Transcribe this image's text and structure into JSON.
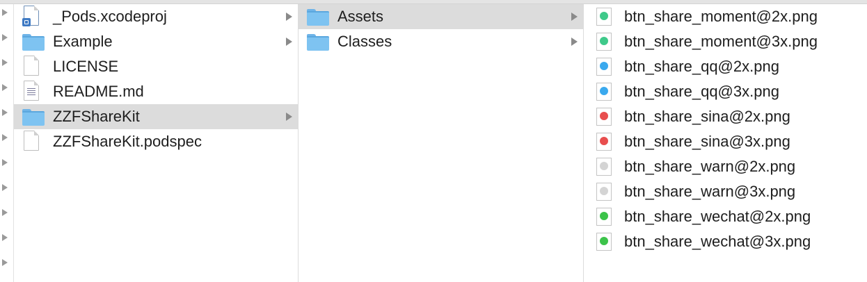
{
  "gutter_arrow_count": 11,
  "column1": {
    "items": [
      {
        "label": "_Pods.xcodeproj",
        "icon": "xcodeproj-icon",
        "has_children": true,
        "selected": false
      },
      {
        "label": "Example",
        "icon": "folder-icon",
        "has_children": true,
        "selected": false
      },
      {
        "label": "LICENSE",
        "icon": "document-icon",
        "has_children": false,
        "selected": false
      },
      {
        "label": "README.md",
        "icon": "text-document-icon",
        "has_children": false,
        "selected": false
      },
      {
        "label": "ZZFShareKit",
        "icon": "folder-icon",
        "has_children": true,
        "selected": true
      },
      {
        "label": "ZZFShareKit.podspec",
        "icon": "document-icon",
        "has_children": false,
        "selected": false
      }
    ]
  },
  "column2": {
    "items": [
      {
        "label": "Assets",
        "icon": "folder-icon",
        "has_children": true,
        "selected": true
      },
      {
        "label": "Classes",
        "icon": "folder-icon",
        "has_children": true,
        "selected": false
      }
    ]
  },
  "column3": {
    "items": [
      {
        "label": "btn_share_moment@2x.png",
        "icon": "png-image-icon",
        "color": "#3fc98a"
      },
      {
        "label": "btn_share_moment@3x.png",
        "icon": "png-image-icon",
        "color": "#3fc98a"
      },
      {
        "label": "btn_share_qq@2x.png",
        "icon": "png-image-icon",
        "color": "#3aa9ee"
      },
      {
        "label": "btn_share_qq@3x.png",
        "icon": "png-image-icon",
        "color": "#3aa9ee"
      },
      {
        "label": "btn_share_sina@2x.png",
        "icon": "png-image-icon",
        "color": "#e84e4e"
      },
      {
        "label": "btn_share_sina@3x.png",
        "icon": "png-image-icon",
        "color": "#e84e4e"
      },
      {
        "label": "btn_share_warn@2x.png",
        "icon": "png-image-icon",
        "color": "#d4d4d4"
      },
      {
        "label": "btn_share_warn@3x.png",
        "icon": "png-image-icon",
        "color": "#d4d4d4"
      },
      {
        "label": "btn_share_wechat@2x.png",
        "icon": "png-image-icon",
        "color": "#3cc34a"
      },
      {
        "label": "btn_share_wechat@3x.png",
        "icon": "png-image-icon",
        "color": "#3cc34a"
      }
    ]
  }
}
